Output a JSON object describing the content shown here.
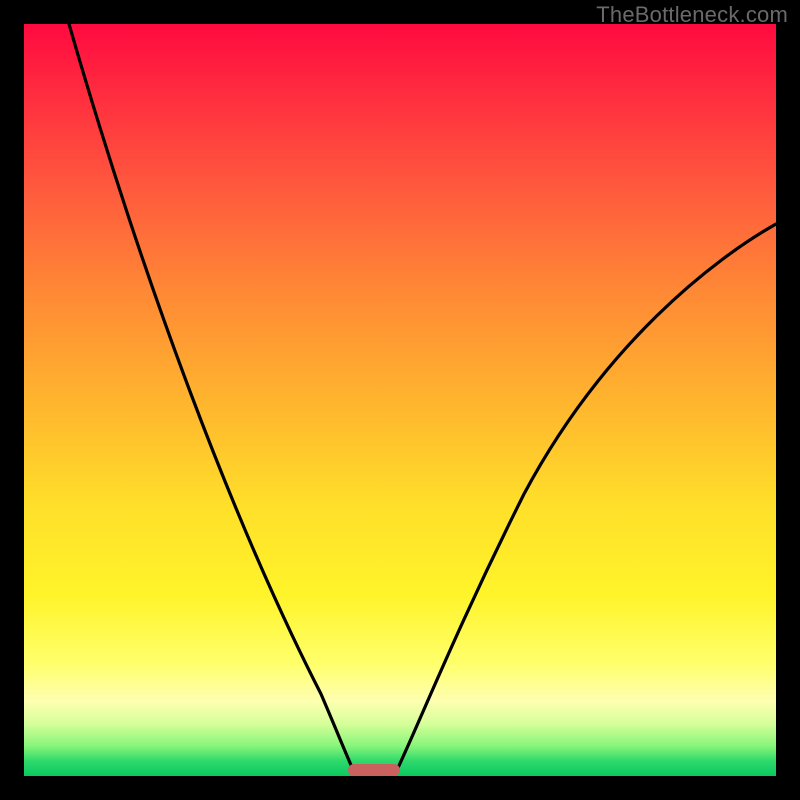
{
  "watermark": "TheBottleneck.com",
  "chart_data": {
    "type": "line",
    "title": "",
    "xlabel": "",
    "ylabel": "",
    "xlim": [
      0,
      100
    ],
    "ylim": [
      0,
      100
    ],
    "grid": false,
    "legend": false,
    "background_gradient": {
      "top": "#ff0a3f",
      "mid": "#ffdf2a",
      "bottom": "#09c961"
    },
    "series": [
      {
        "name": "left-branch",
        "x": [
          6,
          10,
          15,
          20,
          25,
          30,
          35,
          38,
          40,
          42,
          43.5
        ],
        "y": [
          100,
          84,
          67,
          52,
          39,
          27,
          16,
          9,
          5,
          2,
          0
        ]
      },
      {
        "name": "right-branch",
        "x": [
          49,
          52,
          56,
          62,
          70,
          80,
          90,
          100
        ],
        "y": [
          0,
          5,
          13,
          25,
          40,
          55,
          66,
          73
        ]
      }
    ],
    "marker": {
      "name": "minimum-band",
      "x_range": [
        43,
        49
      ],
      "y": 0,
      "color": "#c9615f"
    }
  }
}
